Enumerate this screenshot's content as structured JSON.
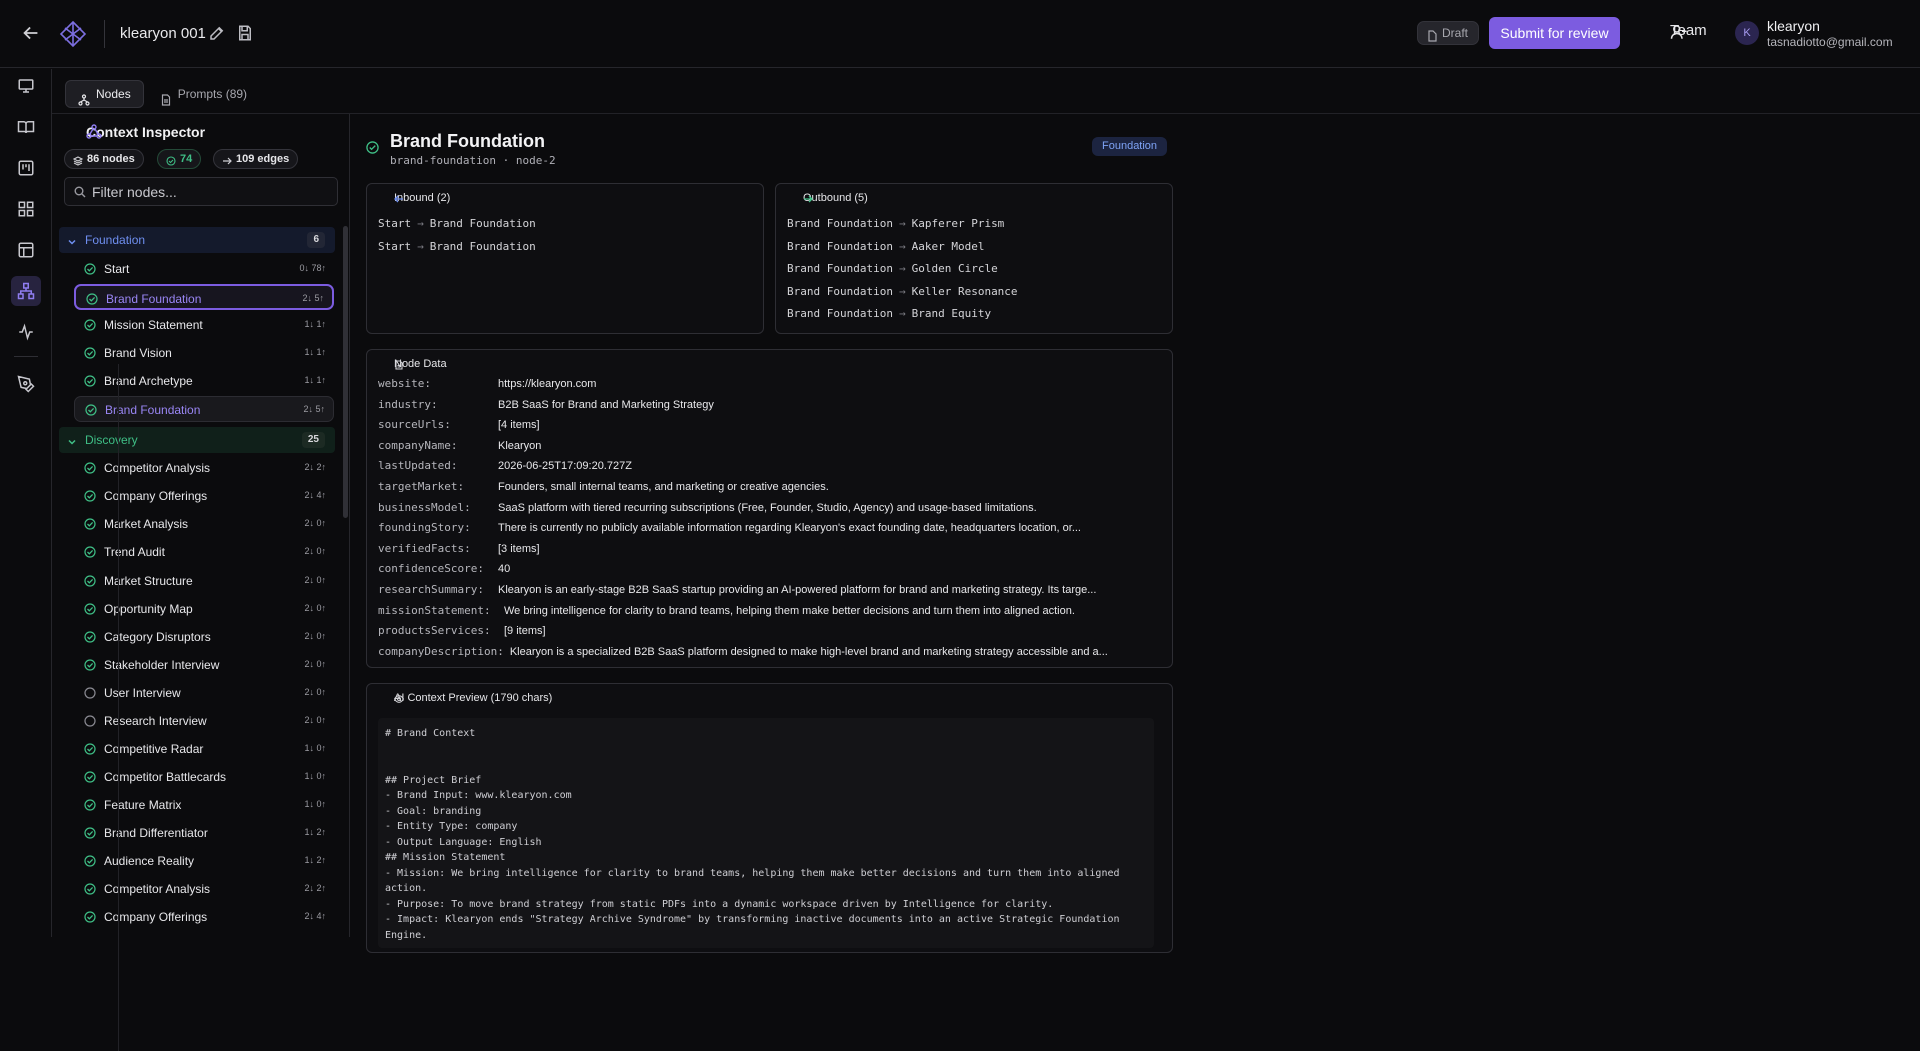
{
  "topbar": {
    "title": "klearyon 001",
    "draft_label": "Draft",
    "submit_label": "Submit for review",
    "team_label": "Team",
    "avatar_initial": "K",
    "user_name": "klearyon",
    "user_email": "tasnadiotto@gmail.com"
  },
  "tabs": [
    {
      "label": "Nodes",
      "icon": "nodes-icon",
      "active": true
    },
    {
      "label": "Prompts (89)",
      "icon": "document-icon",
      "active": false
    }
  ],
  "rail_icons": [
    "presentation-icon",
    "book-icon",
    "kanban-icon",
    "grid-icon",
    "layout-icon",
    "network-icon",
    "activity-icon",
    "pen-tool-icon"
  ],
  "inspector": {
    "title": "Context Inspector",
    "nodes_pill": "86 nodes",
    "done_pill": "74",
    "edges_pill": "109 edges",
    "filter_placeholder": "Filter nodes..."
  },
  "groups": [
    {
      "name": "Foundation",
      "count": "6",
      "color": "#6f8ff0",
      "items": [
        {
          "name": "Start",
          "meta": "0↓ 78↑",
          "status": "done"
        },
        {
          "name": "Brand Foundation",
          "meta": "2↓ 5↑",
          "status": "done",
          "state": "selected"
        },
        {
          "name": "Mission Statement",
          "meta": "1↓ 1↑",
          "status": "done"
        },
        {
          "name": "Brand Vision",
          "meta": "1↓ 1↑",
          "status": "done"
        },
        {
          "name": "Brand Archetype",
          "meta": "1↓ 1↑",
          "status": "done"
        },
        {
          "name": "Brand Foundation",
          "meta": "2↓ 5↑",
          "status": "done",
          "state": "hover"
        }
      ]
    },
    {
      "name": "Discovery",
      "count": "25",
      "color": "#3fbf86",
      "items": [
        {
          "name": "Competitor Analysis",
          "meta": "2↓ 2↑",
          "status": "done"
        },
        {
          "name": "Company Offerings",
          "meta": "2↓ 4↑",
          "status": "done"
        },
        {
          "name": "Market Analysis",
          "meta": "2↓ 0↑",
          "status": "done"
        },
        {
          "name": "Trend Audit",
          "meta": "2↓ 0↑",
          "status": "done"
        },
        {
          "name": "Market Structure",
          "meta": "2↓ 0↑",
          "status": "done"
        },
        {
          "name": "Opportunity Map",
          "meta": "2↓ 0↑",
          "status": "done"
        },
        {
          "name": "Category Disruptors",
          "meta": "2↓ 0↑",
          "status": "done"
        },
        {
          "name": "Stakeholder Interview",
          "meta": "2↓ 0↑",
          "status": "done"
        },
        {
          "name": "User Interview",
          "meta": "2↓ 0↑",
          "status": "pending"
        },
        {
          "name": "Research Interview",
          "meta": "2↓ 0↑",
          "status": "pending"
        },
        {
          "name": "Competitive Radar",
          "meta": "1↓ 0↑",
          "status": "done"
        },
        {
          "name": "Competitor Battlecards",
          "meta": "1↓ 0↑",
          "status": "done"
        },
        {
          "name": "Feature Matrix",
          "meta": "1↓ 0↑",
          "status": "done"
        },
        {
          "name": "Brand Differentiator",
          "meta": "1↓ 2↑",
          "status": "done"
        },
        {
          "name": "Audience Reality",
          "meta": "1↓ 2↑",
          "status": "done"
        },
        {
          "name": "Competitor Analysis",
          "meta": "2↓ 2↑",
          "status": "done"
        },
        {
          "name": "Company Offerings",
          "meta": "2↓ 4↑",
          "status": "done"
        }
      ]
    }
  ],
  "node": {
    "title": "Brand Foundation",
    "subtitle": "brand-foundation · node-2",
    "tag": "Foundation",
    "inbound_title": "Inbound (2)",
    "inbound": [
      {
        "from": "Start",
        "to": "Brand Foundation"
      },
      {
        "from": "Start",
        "to": "Brand Foundation"
      }
    ],
    "outbound_title": "Outbound (5)",
    "outbound": [
      {
        "from": "Brand Foundation",
        "to": "Kapferer Prism"
      },
      {
        "from": "Brand Foundation",
        "to": "Aaker Model"
      },
      {
        "from": "Brand Foundation",
        "to": "Golden Circle"
      },
      {
        "from": "Brand Foundation",
        "to": "Keller Resonance"
      },
      {
        "from": "Brand Foundation",
        "to": "Brand Equity"
      }
    ],
    "data_title": "Node Data",
    "data": [
      {
        "k": "website:",
        "v": "https://klearyon.com"
      },
      {
        "k": "industry:",
        "v": "B2B SaaS for Brand and Marketing Strategy"
      },
      {
        "k": "sourceUrls:",
        "v": "[4 items]"
      },
      {
        "k": "companyName:",
        "v": "Klearyon"
      },
      {
        "k": "lastUpdated:",
        "v": "2026-06-25T17:09:20.727Z"
      },
      {
        "k": "targetMarket:",
        "v": "Founders, small internal teams, and marketing or creative agencies."
      },
      {
        "k": "businessModel:",
        "v": "SaaS platform with tiered recurring subscriptions (Free, Founder, Studio, Agency) and usage-based limitations."
      },
      {
        "k": "foundingStory:",
        "v": "There is currently no publicly available information regarding Klearyon's exact founding date, headquarters location, or..."
      },
      {
        "k": "verifiedFacts:",
        "v": "[3 items]"
      },
      {
        "k": "confidenceScore:",
        "v": "40"
      },
      {
        "k": "researchSummary:",
        "v": "Klearyon is an early-stage B2B SaaS startup providing an AI-powered platform for brand and marketing strategy. Its targe..."
      },
      {
        "k": "missionStatement:",
        "v": "We bring intelligence for clarity to brand teams, helping them make better decisions and turn them into aligned action."
      },
      {
        "k": "productsServices:",
        "v": "[9 items]"
      },
      {
        "k": "companyDescription:",
        "v": "Klearyon is a specialized B2B SaaS platform designed to make high-level brand and marketing strategy accessible and a..."
      }
    ],
    "preview_title": "AI Context Preview (1790 chars)",
    "preview_lines": [
      "# Brand Context",
      "",
      "",
      "## Project Brief",
      "- Brand Input: www.klearyon.com",
      "- Goal: branding",
      "- Entity Type: company",
      "- Output Language: English",
      "## Mission Statement",
      "- Mission: We bring intelligence for clarity to brand teams, helping them make better decisions and turn them into aligned",
      "action.",
      "- Purpose: To move brand strategy from static PDFs into a dynamic workspace driven by Intelligence for clarity.",
      "- Impact: Klearyon ends \"Strategy Archive Syndrome\" by transforming inactive documents into an active Strategic Foundation",
      "Engine."
    ]
  },
  "colors": {
    "accent": "#7c5ce0",
    "done": "#3fbf86",
    "pending": "#8a8a92",
    "foundation": "#6f8ff0"
  }
}
